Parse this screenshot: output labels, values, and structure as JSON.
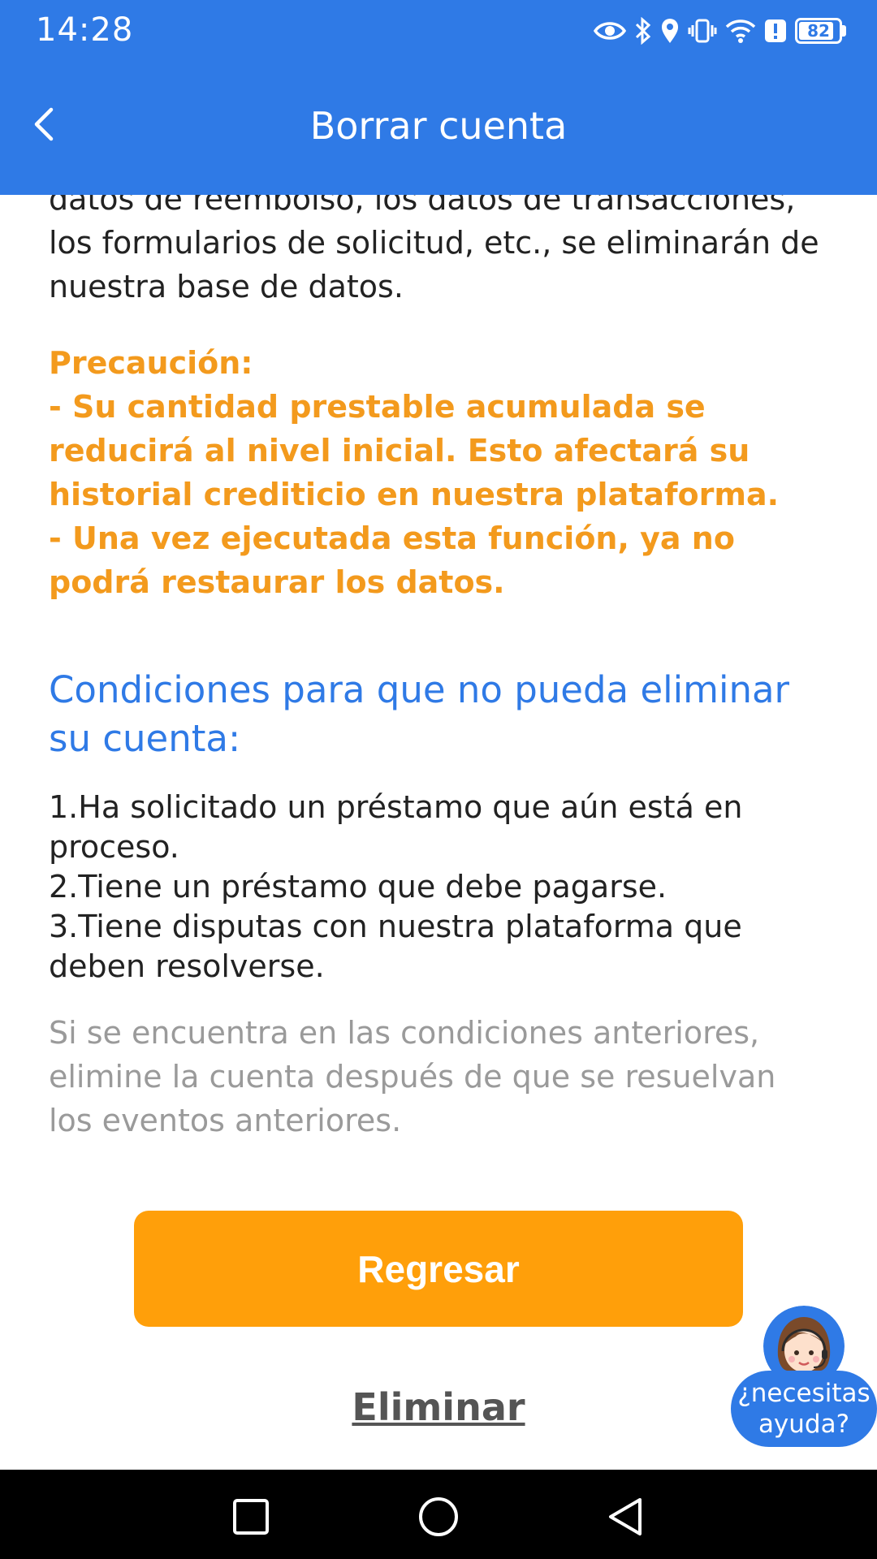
{
  "status_bar": {
    "time": "14:28",
    "battery": "82",
    "icons": [
      "eye-icon",
      "bluetooth-icon",
      "location-icon",
      "vibrate-icon",
      "wifi-icon",
      "alert-icon",
      "battery-icon"
    ]
  },
  "header": {
    "title": "Borrar cuenta",
    "back_icon": "chevron-left-icon"
  },
  "content": {
    "intro_partial": "datos de reembolso, los datos de transacciones, los formularios de solicitud, etc., se eliminarán de nuestra base de datos.",
    "caution_title": "Precaución:",
    "caution_items": [
      "- Su cantidad prestable acumulada se reducirá al nivel inicial. Esto afectará su historial crediticio en nuestra plataforma.",
      "- Una vez ejecutada esta función, ya no podrá restaurar los datos."
    ],
    "conditions_heading": "Condiciones para que no pueda eliminar su cuenta:",
    "conditions": [
      "1.Ha solicitado un préstamo que aún está en proceso.",
      "2.Tiene un préstamo que debe pagarse.",
      "3.Tiene disputas con nuestra plataforma que deben resolverse."
    ],
    "note": "Si se encuentra en las condiciones anteriores, elimine la cuenta después de que se resuelvan los eventos anteriores."
  },
  "actions": {
    "back_label": "Regresar",
    "delete_label": "Eliminar"
  },
  "help": {
    "line1": "¿necesitas",
    "line2": "ayuda?"
  },
  "colors": {
    "primary": "#2f7ae6",
    "accent": "#ff9f0a",
    "caution": "#f39a1d",
    "note": "#9a9a9a"
  }
}
